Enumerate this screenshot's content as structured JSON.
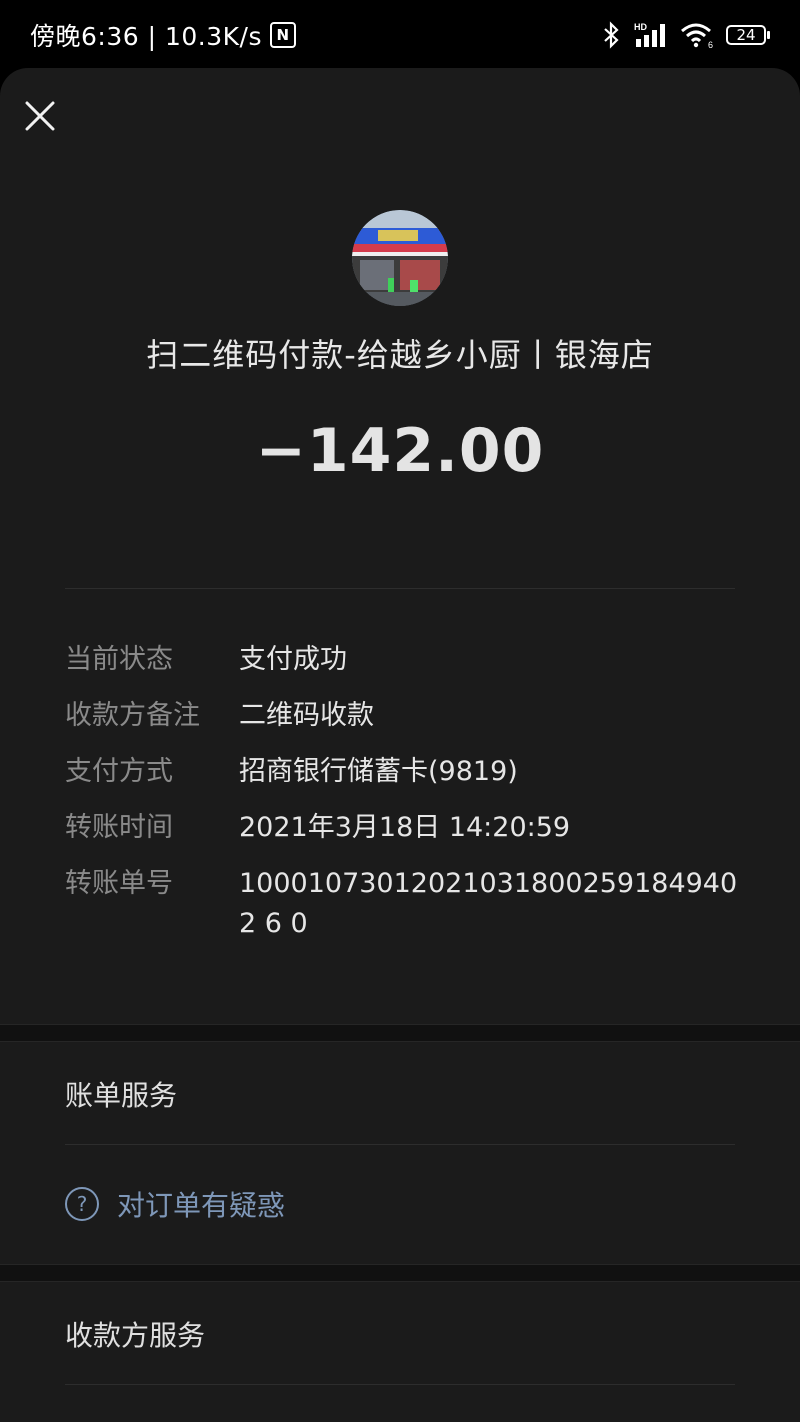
{
  "status_bar": {
    "time_and_speed": "傍晚6:36 | 10.3K/s",
    "nfc_label": "N",
    "hd_label": "HD",
    "wifi_label": "6",
    "battery": "24"
  },
  "header": {
    "merchant_title": "扫二维码付款-给越乡小厨丨银海店",
    "amount": "−142.00"
  },
  "details": [
    {
      "label": "当前状态",
      "value": "支付成功"
    },
    {
      "label": "收款方备注",
      "value": "二维码收款"
    },
    {
      "label": "支付方式",
      "value": "招商银行储蓄卡(9819)"
    },
    {
      "label": "转账时间",
      "value": "2021年3月18日 14:20:59"
    },
    {
      "label": "转账单号",
      "value": "100010730120210318002591849402 6 0"
    }
  ],
  "bill_service": {
    "title": "账单服务",
    "question_link": "对订单有疑惑",
    "question_icon": "?"
  },
  "payee_service": {
    "title": "收款方服务"
  },
  "colors": {
    "background": "#1b1b1b",
    "accent_link": "#7e97b8",
    "label_gray": "#8a8a8a"
  }
}
